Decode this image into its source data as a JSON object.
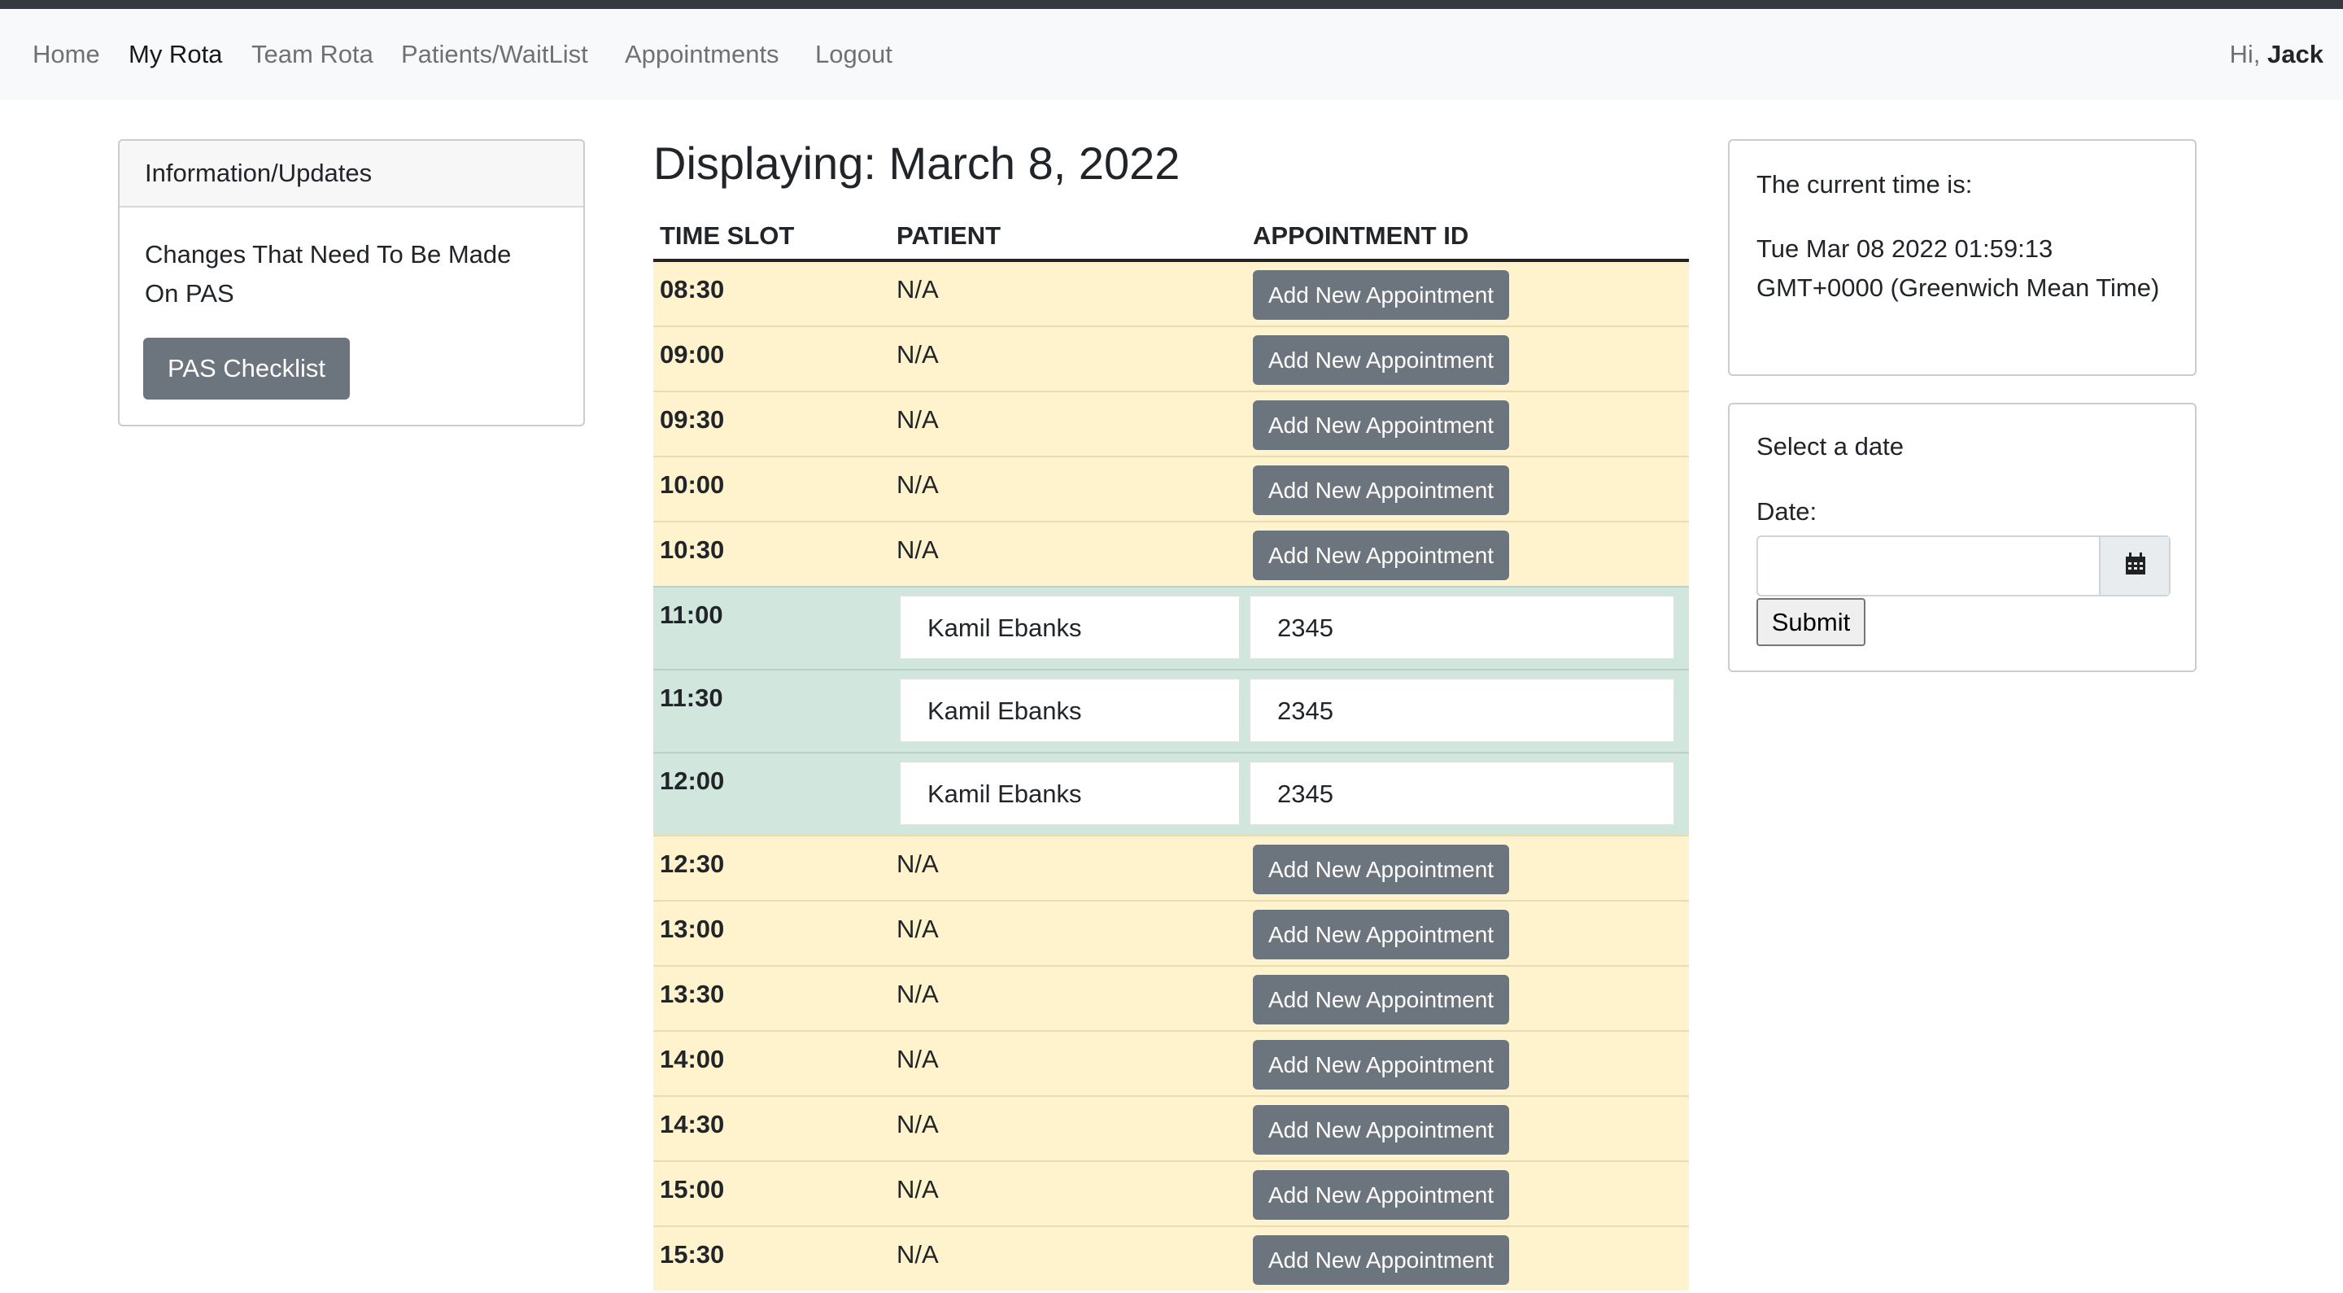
{
  "nav": {
    "items": [
      {
        "label": "Home",
        "active": false
      },
      {
        "label": "My Rota",
        "active": true
      },
      {
        "label": "Team Rota",
        "active": false
      },
      {
        "label": "Patients/WaitList",
        "active": false
      },
      {
        "label": "Appointments",
        "active": false
      },
      {
        "label": "Logout",
        "active": false
      }
    ],
    "greeting_prefix": "Hi,",
    "user_name": "Jack"
  },
  "info_card": {
    "header": "Information/Updates",
    "text": "Changes That Need To Be Made On PAS",
    "button_label": "PAS Checklist"
  },
  "rota": {
    "title": "Displaying: March 8, 2022",
    "columns": [
      "TIME SLOT",
      "PATIENT",
      "APPOINTMENT ID"
    ],
    "add_label": "Add New Appointment",
    "rows": [
      {
        "time": "08:30",
        "patient": "N/A",
        "appointment_id": null
      },
      {
        "time": "09:00",
        "patient": "N/A",
        "appointment_id": null
      },
      {
        "time": "09:30",
        "patient": "N/A",
        "appointment_id": null
      },
      {
        "time": "10:00",
        "patient": "N/A",
        "appointment_id": null
      },
      {
        "time": "10:30",
        "patient": "N/A",
        "appointment_id": null
      },
      {
        "time": "11:00",
        "patient": "Kamil Ebanks",
        "appointment_id": "2345"
      },
      {
        "time": "11:30",
        "patient": "Kamil Ebanks",
        "appointment_id": "2345"
      },
      {
        "time": "12:00",
        "patient": "Kamil Ebanks",
        "appointment_id": "2345"
      },
      {
        "time": "12:30",
        "patient": "N/A",
        "appointment_id": null
      },
      {
        "time": "13:00",
        "patient": "N/A",
        "appointment_id": null
      },
      {
        "time": "13:30",
        "patient": "N/A",
        "appointment_id": null
      },
      {
        "time": "14:00",
        "patient": "N/A",
        "appointment_id": null
      },
      {
        "time": "14:30",
        "patient": "N/A",
        "appointment_id": null
      },
      {
        "time": "15:00",
        "patient": "N/A",
        "appointment_id": null
      },
      {
        "time": "15:30",
        "patient": "N/A",
        "appointment_id": null
      }
    ]
  },
  "time_card": {
    "label": "The current time is:",
    "value": "Tue Mar 08 2022 01:59:13 GMT+0000 (Greenwich Mean Time)"
  },
  "date_card": {
    "title": "Select a date",
    "date_label": "Date:",
    "date_value": "",
    "calendar_icon": "calendar-icon",
    "submit_label": "Submit"
  },
  "colors": {
    "free_row": "#fff3cd",
    "booked_row": "#d1e7dd",
    "button": "#6c757d",
    "topstrip": "#343a40"
  }
}
